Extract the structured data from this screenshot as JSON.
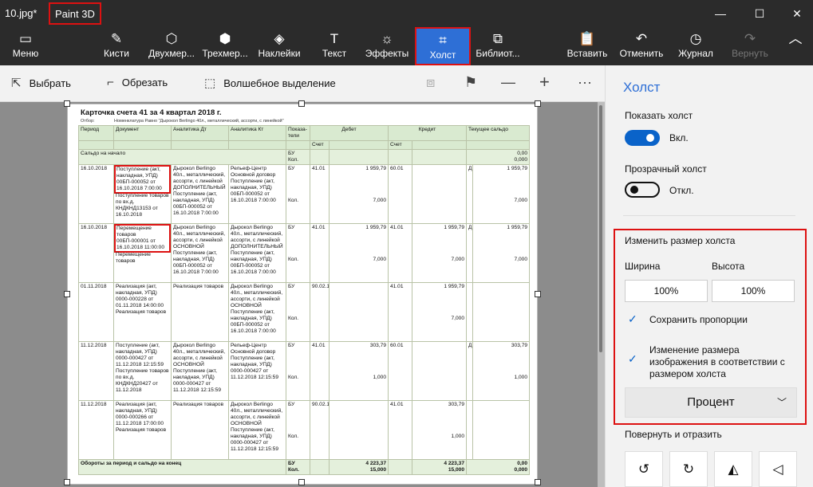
{
  "title": {
    "file": "10.jpg*",
    "app": "Paint 3D"
  },
  "window_controls": {
    "minimize": "—",
    "maximize": "☐",
    "close": "✕"
  },
  "ribbon": {
    "menu": "Меню",
    "brushes": "Кисти",
    "shapes2d": "Двухмер...",
    "shapes3d": "Трехмер...",
    "stickers": "Наклейки",
    "text": "Текст",
    "effects": "Эффекты",
    "canvas": "Холст",
    "library": "Библиот...",
    "paste": "Вставить",
    "undo": "Отменить",
    "history": "Журнал",
    "redo": "Вернуть",
    "collapse": "︿"
  },
  "icons": {
    "menu": "▭",
    "brushes": "✎",
    "shapes2d": "⬡",
    "shapes3d": "⬢",
    "stickers": "◈",
    "text": "T",
    "effects": "☼",
    "canvas": "⌗",
    "library": "⧉",
    "paste": "📋",
    "undo": "↶",
    "history": "◷",
    "redo": "↷",
    "select": "⇱",
    "crop": "⌐",
    "magic": "⬚",
    "view3d": "⧈",
    "flag": "⚑",
    "zoom_out": "—",
    "zoom_in": "+",
    "more": "···",
    "rotate_left": "↺",
    "rotate_right": "↻",
    "flip_v": "◭",
    "flip_h": "◁"
  },
  "toolbar": {
    "select": "Выбрать",
    "crop": "Обрезать",
    "magic": "Волшебное выделение"
  },
  "panel": {
    "title": "Холст",
    "show_canvas": "Показать холст",
    "show_state": "Вкл.",
    "transparent": "Прозрачный холст",
    "transparent_state": "Откл.",
    "resize_title": "Изменить размер холста",
    "width_label": "Ширина",
    "height_label": "Высота",
    "width_value": "100%",
    "height_value": "100%",
    "keep_ratio": "Сохранить пропорции",
    "resize_image_1": "Изменение размера",
    "resize_image_2": "изображения в соответствии с",
    "resize_image_3": "размером холста",
    "unit": "Процент",
    "rotate_title": "Повернуть и отразить"
  },
  "document": {
    "title": "Карточка счета 41 за 4 квартал 2018 г.",
    "subtitle_left": "Отбор:",
    "subtitle_right": "Номенклатура Равно \"Дырокол Berlingo 40л., металлический, ассорти, с линейкой\"",
    "headers": {
      "period": "Период",
      "doc": "Документ",
      "an_dt": "Аналитика Дт",
      "an_kt": "Аналитика Кт",
      "ind": "Показа-\nтели",
      "debet": "Дебет",
      "kredit": "Кредит",
      "saldo": "Текущее сальдо",
      "acc": "Счет"
    },
    "saldo_start": {
      "label": "Сальдо на начало",
      "bu": "БУ",
      "kol": "Кол.",
      "v1": "0,00",
      "v2": "0,000"
    },
    "rows": [
      {
        "date": "16.10.2018",
        "doc_boxed": "Поступление (акт, накладная, УПД) 00БП-000052 от 16.10.2018 7:00:00",
        "doc_rest": "Поступление товаров по вх.д. КНДКНД13153 от 16.10.2018",
        "an_dt": "Дырокол Berlingo 40л., металлический, ассорти, с линейкой ДОПОЛНИТЕЛЬНЫЙ Поступление (акт, накладная, УПД) 00БП-000052 от 16.10.2018 7:00:00",
        "an_kt": "Рельеф-Центр Основной договор Поступление (акт, накладная, УПД) 00БП-000052 от 16.10.2018 7:00:00",
        "ind1": "БУ",
        "ind2": "Кол.",
        "d_acc": "41.01",
        "d_val": "1 959,79",
        "d_qty": "7,000",
        "k_acc": "60.01",
        "k_val": "",
        "k_qty": "",
        "s_type": "Д",
        "s_val": "1 959,79",
        "s_qty": "7,000"
      },
      {
        "date": "16.10.2018",
        "doc_boxed": "Перемещение товаров 00БП-000001 от 16.10.2018 11:00:00",
        "doc_rest": "Перемещение товаров",
        "an_dt": "Дырокол Berlingo 40л., металлический, ассорти, с линейкой ОСНОВНОЙ Поступление (акт, накладная, УПД) 00БП-000052 от 16.10.2018 7:00:00",
        "an_kt": "Дырокол Berlingo 40л., металлический, ассорти, с линейкой ДОПОЛНИТЕЛЬНЫЙ Поступление (акт, накладная, УПД) 00БП-000052 от 16.10.2018 7:00:00",
        "ind1": "БУ",
        "ind2": "Кол.",
        "d_acc": "41.01",
        "d_val": "1 959,79",
        "d_qty": "7,000",
        "k_acc": "41.01",
        "k_val": "1 959,79",
        "k_qty": "7,000",
        "s_type": "Д",
        "s_val": "1 959,79",
        "s_qty": "7,000"
      },
      {
        "date": "01.11.2018",
        "doc_boxed": "",
        "doc_rest": "Реализация (акт, накладная, УПД) 0000-000228 от 01.11.2018 14:00:00 Реализация товаров",
        "an_dt": "Реализация товаров",
        "an_kt": "Дырокол Berlingo 40л., металлический, ассорти, с линейкой ОСНОВНОЙ Поступление (акт, накладная, УПД) 00БП-000052 от 16.10.2018 7:00:00",
        "ind1": "БУ",
        "ind2": "Кол.",
        "d_acc": "90.02.1",
        "d_val": "",
        "d_qty": "",
        "k_acc": "41.01",
        "k_val": "1 959,79",
        "k_qty": "7,000",
        "s_type": "",
        "s_val": "",
        "s_qty": ""
      },
      {
        "date": "11.12.2018",
        "doc_boxed": "",
        "doc_rest": "Поступление (акт, накладная, УПД) 0000-000427 от 11.12.2018 12:15:59 Поступление товаров по вх.д. КНДКНД20427 от 11.12.2018",
        "an_dt": "Дырокол Berlingo 40л., металлический, ассорти, с линейкой ОСНОВНОЙ Поступление (акт, накладная, УПД) 0000-000427 от 11.12.2018 12:15:59",
        "an_kt": "Рельеф-Центр Основной договор Поступление (акт, накладная, УПД) 0000-000427 от 11.12.2018 12:15:59",
        "ind1": "БУ",
        "ind2": "Кол.",
        "d_acc": "41.01",
        "d_val": "303,79",
        "d_qty": "1,000",
        "k_acc": "60.01",
        "k_val": "",
        "k_qty": "",
        "s_type": "Д",
        "s_val": "303,79",
        "s_qty": "1,000"
      },
      {
        "date": "11.12.2018",
        "doc_boxed": "",
        "doc_rest": "Реализация (акт, накладная, УПД) 0000-000266 от 11.12.2018 17:00:00 Реализация товаров",
        "an_dt": "Реализация товаров",
        "an_kt": "Дырокол Berlingo 40л., металлический, ассорти, с линейкой ОСНОВНОЙ Поступление (акт, накладная, УПД) 0000-000427 от 11.12.2018 12:15:59",
        "ind1": "БУ",
        "ind2": "Кол.",
        "d_acc": "90.02.1",
        "d_val": "",
        "d_qty": "",
        "k_acc": "41.01",
        "k_val": "303,79",
        "k_qty": "1,000",
        "s_type": "",
        "s_val": "",
        "s_qty": ""
      }
    ],
    "totals": {
      "label": "Обороты за период и сальдо на конец",
      "bu": "БУ",
      "kol": "Кол.",
      "d_val": "4 223,37",
      "d_qty": "15,000",
      "k_val": "4 223,37",
      "k_qty": "15,000",
      "s_val": "0,00",
      "s_qty": "0,000"
    }
  }
}
